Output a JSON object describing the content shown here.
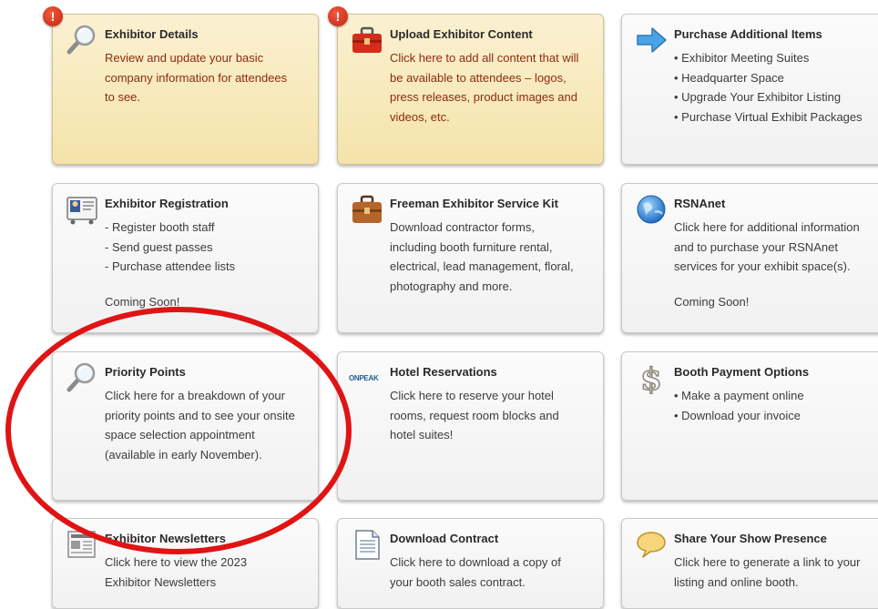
{
  "alert_badge_text": "!",
  "colors": {
    "alert_card_top": "#fbf1d2",
    "alert_card_bottom": "#f4e3aa",
    "alert_text": "#8e2a10",
    "badge_red": "#d43417",
    "annotation_circle": "#e01414"
  },
  "cards": [
    {
      "title": "Exhibitor Details",
      "icon": "magnifier-icon",
      "alert": true,
      "lines": [
        "Review and update your basic",
        "company information for attendees",
        "to see."
      ]
    },
    {
      "title": "Upload Exhibitor Content",
      "icon": "red-briefcase-icon",
      "alert": true,
      "lines": [
        "Click here to add all content that will",
        "be available to attendees – logos,",
        "press releases, product images and",
        "videos, etc."
      ]
    },
    {
      "title": "Purchase Additional Items",
      "icon": "blue-arrow-icon",
      "alert": false,
      "lines": [
        "• Exhibitor Meeting Suites",
        "• Headquarter Space",
        "• Upgrade Your Exhibitor Listing",
        "• Purchase Virtual Exhibit Packages"
      ]
    },
    {
      "title": "Exhibitor Registration",
      "icon": "id-badge-icon",
      "alert": false,
      "lines": [
        "- Register booth staff",
        "- Send guest passes",
        "- Purchase attendee lists"
      ],
      "note": "Coming Soon!"
    },
    {
      "title": "Freeman Exhibitor Service Kit",
      "icon": "brown-briefcase-icon",
      "alert": false,
      "lines": [
        "Download contractor forms,",
        "including booth furniture rental,",
        "electrical, lead management, floral,",
        "photography and more."
      ]
    },
    {
      "title": "RSNAnet",
      "icon": "globe-icon",
      "alert": false,
      "lines": [
        "Click here for additional information",
        "and to purchase your RSNAnet",
        "services for your exhibit space(s)."
      ],
      "note": "Coming Soon!"
    },
    {
      "title": "Priority Points",
      "icon": "magnifier-icon",
      "alert": false,
      "lines": [
        "Click here for a breakdown of your",
        "priority points and to see your onsite",
        "space selection appointment",
        "(available in early November)."
      ]
    },
    {
      "title": "Hotel Reservations",
      "icon": "onpeak-logo-icon",
      "icon_text": "ONPEAK",
      "alert": false,
      "lines": [
        "Click here to reserve your hotel",
        "rooms, request room blocks and",
        "hotel suites!"
      ]
    },
    {
      "title": "Booth Payment Options",
      "icon": "dollar-sign-icon",
      "alert": false,
      "lines": [
        "• Make a payment online",
        "• Download your invoice"
      ]
    },
    {
      "title": "Exhibitor Newsletters",
      "icon": "newspaper-icon",
      "alert": false,
      "lines": [
        "Click here to view the 2023",
        "Exhibitor Newsletters"
      ]
    },
    {
      "title": "Download Contract",
      "icon": "document-icon",
      "alert": false,
      "lines": [
        "Click here to download a copy of",
        "your booth sales contract."
      ]
    },
    {
      "title": "Share Your Show Presence",
      "icon": "speech-bubble-icon",
      "alert": false,
      "lines": [
        "Click here to generate a link to your",
        "listing and online booth."
      ]
    }
  ]
}
